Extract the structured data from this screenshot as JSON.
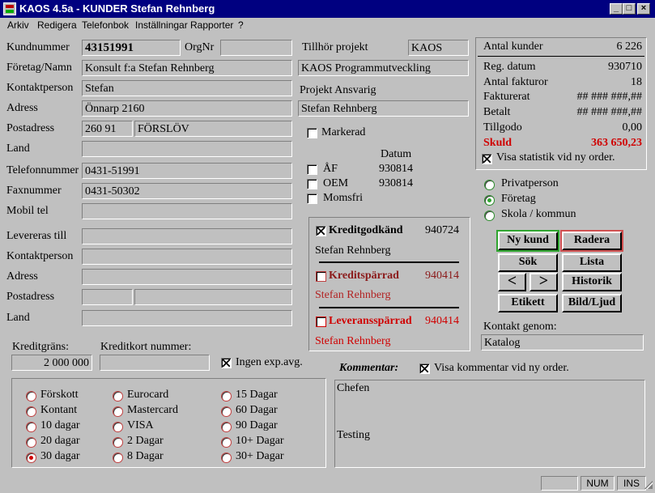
{
  "window": {
    "title": "KAOS 4.5a - KUNDER  Stefan Rehnberg",
    "min": "_",
    "max": "□",
    "close": "×"
  },
  "menu": [
    "Arkiv",
    "Redigera",
    "Telefonbok",
    "Inställningar",
    "Rapporter",
    "?"
  ],
  "customer": {
    "kundnummer_label": "Kundnummer",
    "kundnummer": "43151991",
    "orgnr_label": "OrgNr",
    "orgnr": "",
    "foretag_label": "Företag/Namn",
    "foretag": "Konsult f:a Stefan Rehnberg",
    "kontakt_label": "Kontaktperson",
    "kontakt": "Stefan",
    "adress_label": "Adress",
    "adress": "Önnarp 2160",
    "postadress_label": "Postadress",
    "postnr": "260 91",
    "ort": "FÖRSLÖV",
    "land_label": "Land",
    "land": "",
    "telefon_label": "Telefonnummer",
    "telefon": "0431-51991",
    "fax_label": "Faxnummer",
    "fax": "0431-50302",
    "mobil_label": "Mobil tel",
    "mobil": ""
  },
  "delivery": {
    "levereras_label": "Levereras till",
    "levereras": "",
    "kontakt_label": "Kontaktperson",
    "kontakt": "",
    "adress_label": "Adress",
    "adress": "",
    "postadress_label": "Postadress",
    "postnr": "",
    "ort": "",
    "land_label": "Land",
    "land": ""
  },
  "credit": {
    "limit_label": "Kreditgräns:",
    "limit": "2 000 000",
    "card_label": "Kreditkort nummer:",
    "card": "",
    "no_fee_label": "Ingen exp.avg.",
    "no_fee_checked": true
  },
  "project": {
    "tillhor_label": "Tillhör projekt",
    "tillhor": "KAOS",
    "name": "KAOS Programmutveckling",
    "ansvarig_label": "Projekt Ansvarig",
    "ansvarig": "Stefan Rehnberg"
  },
  "flags": {
    "markerad_label": "Markerad",
    "datum_label": "Datum",
    "af_label": "ÅF",
    "af_date": "930814",
    "oem_label": "OEM",
    "oem_date": "930814",
    "momsfri_label": "Momsfri"
  },
  "credit_status": {
    "godkand_label": "Kreditgodkänd",
    "godkand_date": "940724",
    "godkand_by": "Stefan Rehnberg",
    "sparrad_label": "Kreditspärrad",
    "sparrad_date": "940414",
    "sparrad_by": "Stefan Rehnberg",
    "lev_sparrad_label": "Leveransspärrad",
    "lev_sparrad_date": "940414",
    "lev_sparrad_by": "Stefan Rehnberg"
  },
  "stats": {
    "antal_kunder_label": "Antal kunder",
    "antal_kunder": "6 226",
    "reg_datum_label": "Reg. datum",
    "reg_datum": "930710",
    "antal_fakturor_label": "Antal fakturor",
    "antal_fakturor": "18",
    "fakturerat_label": "Fakturerat",
    "fakturerat": "## ### ###,##",
    "betalt_label": "Betalt",
    "betalt": "## ### ###,##",
    "tillgodo_label": "Tillgodo",
    "tillgodo": "0,00",
    "skuld_label": "Skuld",
    "skuld": "363 650,23",
    "visa_stat_label": "Visa statistik vid ny order."
  },
  "customer_type": {
    "options": [
      "Privatperson",
      "Företag",
      "Skola / kommun"
    ],
    "selected": "Företag"
  },
  "buttons": {
    "ny_kund": "Ny kund",
    "radera": "Radera",
    "sok": "Sök",
    "lista": "Lista",
    "prev": "<",
    "next": ">",
    "historik": "Historik",
    "etikett": "Etikett",
    "bild_ljud": "Bild/Ljud"
  },
  "contact_via": {
    "label": "Kontakt genom:",
    "value": "Katalog"
  },
  "comment": {
    "label": "Kommentar:",
    "visa_label": "Visa kommentar vid ny order.",
    "line1": "Chefen",
    "line2": "Testing"
  },
  "payment": {
    "col1": [
      "Förskott",
      "Kontant",
      "10 dagar",
      "20 dagar",
      "30 dagar"
    ],
    "col2": [
      "Eurocard",
      "Mastercard",
      "VISA",
      "2 Dagar",
      "8 Dagar"
    ],
    "col3": [
      "15 Dagar",
      "60 Dagar",
      "90 Dagar",
      "10+ Dagar",
      "30+ Dagar"
    ],
    "selected": "30 dagar"
  },
  "statusbar": {
    "num": "NUM",
    "ins": "INS"
  },
  "colors": {
    "title_bg": "#000080",
    "face": "#c0c0c0",
    "accent_red": "#d00000",
    "dark_red": "#8b1a1a",
    "green": "#2fa52f"
  }
}
